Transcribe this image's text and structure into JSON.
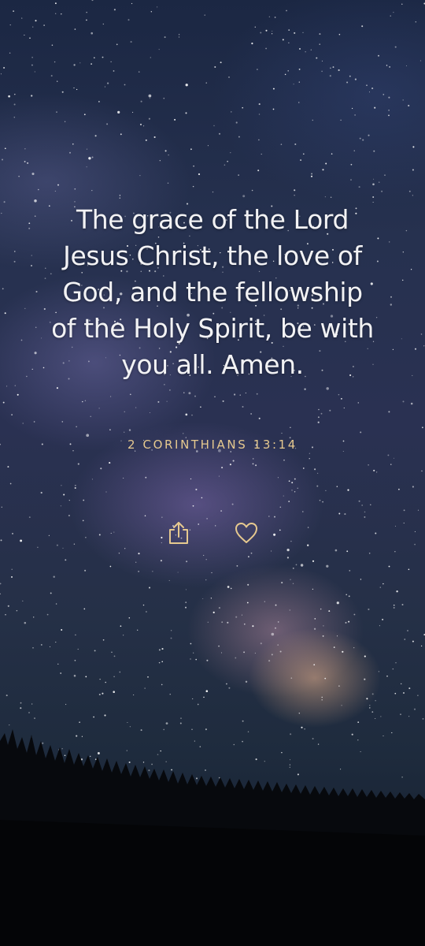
{
  "verse": {
    "lines": [
      "The grace of the Lord",
      "Jesus Christ, the love of",
      "God, and the fellowship",
      "of the Holy Spirit, be with",
      "you all. Amen."
    ],
    "reference": "2 CORINTHIANS 13:14"
  },
  "actions": {
    "share_icon": "share-icon",
    "like_icon": "heart-icon"
  },
  "colors": {
    "verse_text": "#f2f2f4",
    "accent": "#e6c98f"
  }
}
